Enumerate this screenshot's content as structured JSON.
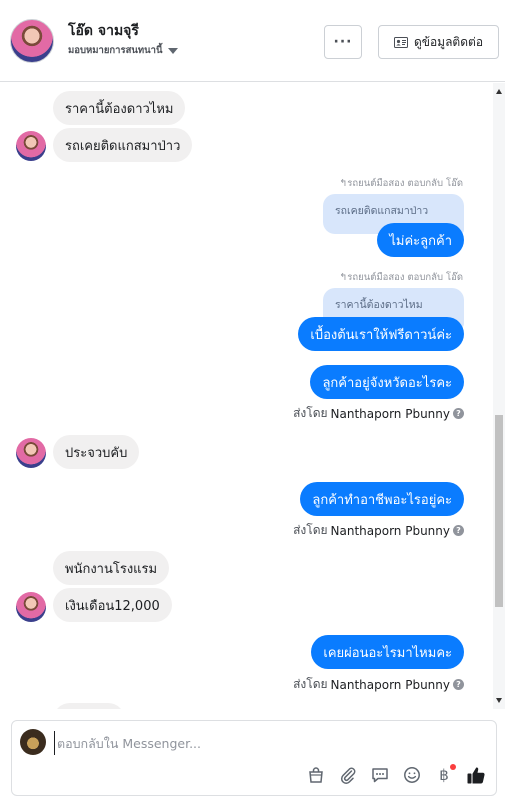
{
  "header": {
    "name": "โอ๊ด จามจุรี",
    "assign_label": "มอบหมายการสนทนานี้",
    "more_label": "···",
    "contact_label": "ดูข้อมูลติดต่อ"
  },
  "messages": [
    {
      "text": "ราคานี้ต้องดาวไหม"
    },
    {
      "text": "รถเคยติดแกสมาป่าว"
    },
    {
      "reply_label": "↰รถยนต์มือสอง ตอบกลับ โอ๊ด",
      "quote": "รถเคยติดแกสมาป่าว",
      "text": "ไม่ค่ะลูกค้า"
    },
    {
      "reply_label": "↰รถยนต์มือสอง ตอบกลับ โอ๊ด",
      "quote": "ราคานี้ต้องดาวไหม",
      "text": "เบื้องต้นเราให้ฟรีดาวน์ค่ะ"
    },
    {
      "text": "ลูกค้าอยู่จังหวัดอะไรคะ"
    },
    {
      "sent_by_prefix": "ส่งโดย",
      "sent_by_name": "Nanthaporn Pbunny"
    },
    {
      "text": "ประจวบคับ"
    },
    {
      "text": "ลูกค้าทำอาชีพอะไรอยู่คะ"
    },
    {
      "sent_by_prefix": "ส่งโดย",
      "sent_by_name": "Nanthaporn Pbunny"
    },
    {
      "text": "พนักงานโรงแรม"
    },
    {
      "text": "เงินเดือน12,000"
    },
    {
      "text": "เคยผ่อนอะไรมาไหมคะ"
    },
    {
      "sent_by_prefix": "ส่งโดย",
      "sent_by_name": "Nanthaporn Pbunny"
    }
  ],
  "composer": {
    "placeholder": "ตอบกลับใน Messenger..."
  },
  "colors": {
    "outgoing": "#0a7cff",
    "incoming": "#f1f0f0",
    "quote": "#d8e6fb"
  },
  "icons": [
    "more-icon",
    "contact-card-icon",
    "shop-bag-icon",
    "attach-icon",
    "saved-reply-icon",
    "emoji-icon",
    "baht-payment-icon",
    "like-icon"
  ]
}
